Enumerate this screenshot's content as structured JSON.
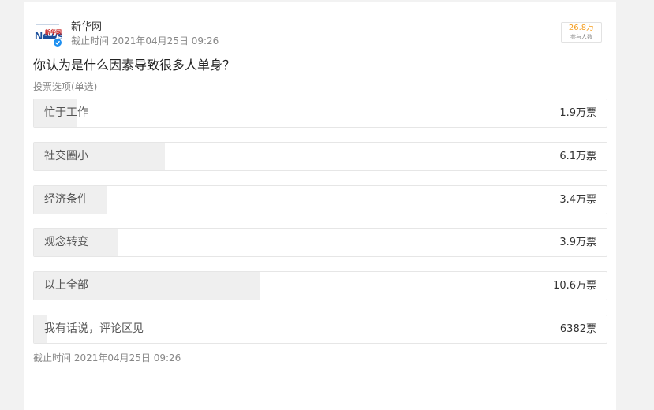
{
  "author": {
    "name": "新华网",
    "deadline": "截止时间 2021年04月25日 09:26",
    "logo_text": "新华网",
    "logo_news": "News"
  },
  "participants": {
    "count": "26.8万",
    "caption": "参与人数"
  },
  "poll": {
    "question": "你认为是什么因素导致很多人单身？",
    "vote_type": "投票选项(单选)",
    "options": [
      {
        "label": "忙于工作",
        "votes": "1.9万票",
        "share": 0.076
      },
      {
        "label": "社交圈小",
        "votes": "6.1万票",
        "share": 0.229
      },
      {
        "label": "经济条件",
        "votes": "3.4万票",
        "share": 0.128
      },
      {
        "label": "观念转变",
        "votes": "3.9万票",
        "share": 0.148
      },
      {
        "label": "以上全部",
        "votes": "10.6万票",
        "share": 0.396
      },
      {
        "label": "我有话说，评论区见",
        "votes": "6382票",
        "share": 0.024
      }
    ],
    "footer_deadline": "截止时间 2021年04月25日 09:26"
  },
  "colors": {
    "accent": "#f59c1b",
    "bar_fill": "#efefef",
    "verified": "#1d8ff0"
  }
}
